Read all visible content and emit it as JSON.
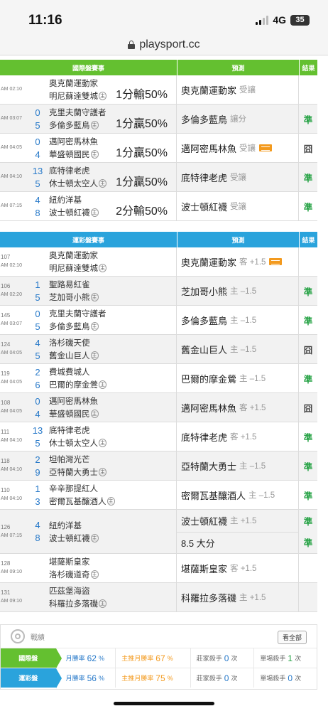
{
  "status": {
    "time": "11:16",
    "network": "4G",
    "battery": "35"
  },
  "url": "playsport.cc",
  "intl": {
    "header": {
      "match": "國際盤賽事",
      "prediction": "預測",
      "result": "結果"
    },
    "rows": [
      {
        "time": "AM 02:10",
        "s1": "",
        "t1": "奧克蘭運動家",
        "s2": "",
        "t2": "明尼蘇達雙城",
        "spread": "1分輸50%",
        "pred": "奧克蘭運動家",
        "pred_sub": "受讓",
        "hot": false,
        "result": ""
      },
      {
        "time": "AM 03:07",
        "s1": "0",
        "t1": "克里夫蘭守護者",
        "s2": "5",
        "t2": "多倫多藍鳥",
        "spread": "1分贏50%",
        "pred": "多倫多藍鳥",
        "pred_sub": "讓分",
        "hot": false,
        "result": "準"
      },
      {
        "time": "AM 04:05",
        "s1": "0",
        "t1": "邁阿密馬林魚",
        "s2": "4",
        "t2": "華盛頓國民",
        "spread": "1分贏50%",
        "pred": "邁阿密馬林魚",
        "pred_sub": "受讓",
        "hot": true,
        "result": "囧"
      },
      {
        "time": "AM 04:10",
        "s1": "13",
        "t1": "底特律老虎",
        "s2": "5",
        "t2": "休士頓太空人",
        "spread": "1分贏50%",
        "pred": "底特律老虎",
        "pred_sub": "受讓",
        "hot": false,
        "result": "準"
      },
      {
        "time": "AM 07:15",
        "s1": "4",
        "t1": "紐約洋基",
        "s2": "8",
        "t2": "波士頓紅襪",
        "spread": "2分輸50%",
        "pred": "波士頓紅襪",
        "pred_sub": "受讓",
        "hot": false,
        "result": "準"
      }
    ]
  },
  "lottery": {
    "header": {
      "match": "運彩盤賽事",
      "prediction": "預測",
      "result": "結果"
    },
    "rows": [
      {
        "gid": "107",
        "time": "AM 02:10",
        "s1": "",
        "t1": "奧克蘭運動家",
        "s2": "",
        "t2": "明尼蘇達雙城",
        "pred": "奧克蘭運動家",
        "pred_sub": "客 +1.5",
        "hot": true,
        "result": ""
      },
      {
        "gid": "106",
        "time": "AM 02:20",
        "s1": "1",
        "t1": "聖路易紅雀",
        "s2": "5",
        "t2": "芝加哥小熊",
        "pred": "芝加哥小熊",
        "pred_sub": "主 –1.5",
        "hot": false,
        "result": "準"
      },
      {
        "gid": "145",
        "time": "AM 03:07",
        "s1": "0",
        "t1": "克里夫蘭守護者",
        "s2": "5",
        "t2": "多倫多藍鳥",
        "pred": "多倫多藍鳥",
        "pred_sub": "主 –1.5",
        "hot": false,
        "result": "準"
      },
      {
        "gid": "124",
        "time": "AM 04:05",
        "s1": "4",
        "t1": "洛杉磯天使",
        "s2": "5",
        "t2": "舊金山巨人",
        "pred": "舊金山巨人",
        "pred_sub": "主 –1.5",
        "hot": false,
        "result": "囧"
      },
      {
        "gid": "119",
        "time": "AM 04:05",
        "s1": "2",
        "t1": "費城費城人",
        "s2": "6",
        "t2": "巴爾的摩金鶯",
        "pred": "巴爾的摩金鶯",
        "pred_sub": "主 –1.5",
        "hot": false,
        "result": "準"
      },
      {
        "gid": "108",
        "time": "AM 04:05",
        "s1": "0",
        "t1": "邁阿密馬林魚",
        "s2": "4",
        "t2": "華盛頓國民",
        "pred": "邁阿密馬林魚",
        "pred_sub": "客 +1.5",
        "hot": false,
        "result": "囧"
      },
      {
        "gid": "111",
        "time": "AM 04:10",
        "s1": "13",
        "t1": "底特律老虎",
        "s2": "5",
        "t2": "休士頓太空人",
        "pred": "底特律老虎",
        "pred_sub": "客 +1.5",
        "hot": false,
        "result": "準"
      },
      {
        "gid": "118",
        "time": "AM 04:10",
        "s1": "2",
        "t1": "坦帕灣光芒",
        "s2": "9",
        "t2": "亞特蘭大勇士",
        "pred": "亞特蘭大勇士",
        "pred_sub": "主 –1.5",
        "hot": false,
        "result": "準"
      },
      {
        "gid": "110",
        "time": "AM 04:10",
        "s1": "1",
        "t1": "辛辛那提紅人",
        "s2": "3",
        "t2": "密爾瓦基釀酒人",
        "pred": "密爾瓦基釀酒人",
        "pred_sub": "主 –1.5",
        "hot": false,
        "result": "準"
      },
      {
        "gid": "126",
        "time": "AM 07:15",
        "s1": "4",
        "t1": "紐約洋基",
        "s2": "8",
        "t2": "波士頓紅襪",
        "pred": "波士頓紅襪",
        "pred_sub": "主 +1.5",
        "hot": false,
        "result": "準",
        "pred2": "8.5 大分",
        "pred2_sub": "",
        "result2": "準"
      },
      {
        "gid": "128",
        "time": "AM 09:10",
        "s1": "",
        "t1": "堪薩斯皇家",
        "s2": "",
        "t2": "洛杉磯道奇",
        "pred": "堪薩斯皇家",
        "pred_sub": "客 +1.5",
        "hot": false,
        "result": ""
      },
      {
        "gid": "131",
        "time": "AM 09:10",
        "s1": "",
        "t1": "匹茲堡海盜",
        "s2": "",
        "t2": "科羅拉多落磯",
        "pred": "科羅拉多落磯",
        "pred_sub": "主 +1.5",
        "hot": false,
        "result": ""
      }
    ]
  },
  "stats": {
    "title": "戰績",
    "view_all": "看全部",
    "rows": [
      {
        "tag": "國際盤",
        "monthly_label": "月勝率",
        "monthly": "62",
        "main_label": "主推月勝率",
        "main": "67",
        "pct": "%",
        "banker_label": "莊家殺手",
        "banker": "0",
        "single_label": "單場殺手",
        "single": "1",
        "unit": "次"
      },
      {
        "tag": "運彩盤",
        "monthly_label": "月勝率",
        "monthly": "56",
        "main_label": "主推月勝率",
        "main": "75",
        "pct": "%",
        "banker_label": "莊家殺手",
        "banker": "0",
        "single_label": "單場殺手",
        "single": "0",
        "unit": "次"
      }
    ]
  }
}
